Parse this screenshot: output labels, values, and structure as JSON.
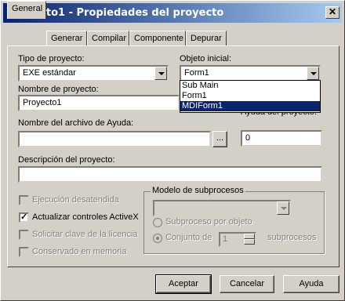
{
  "window": {
    "title": "Proyecto1 - Propiedades del proyecto",
    "close_glyph": "✕"
  },
  "tabs": [
    {
      "label": "General",
      "active": true
    },
    {
      "label": "Generar"
    },
    {
      "label": "Compilar"
    },
    {
      "label": "Componente"
    },
    {
      "label": "Depurar"
    }
  ],
  "general": {
    "project_type_label": "Tipo de proyecto:",
    "project_type_value": "EXE estándar",
    "startup_object_label": "Objeto inicial:",
    "startup_object_value": "Form1",
    "startup_options": [
      "Sub Main",
      "Form1",
      "MDIForm1"
    ],
    "startup_selected_index": 2,
    "project_name_label": "Nombre de proyecto:",
    "project_name_value": "Proyecto1",
    "help_file_label": "Nombre del archivo de Ayuda:",
    "help_file_value": "",
    "browse_label": "...",
    "help_context_label": "Ayuda del proyecto:",
    "help_context_value": "0",
    "description_label": "Descripción del proyecto:",
    "description_value": "",
    "unattended_label": "Ejecución desatendida",
    "upgrade_activex_label": "Actualizar controles ActiveX",
    "license_key_label": "Solicitar clave de la licencia",
    "retained_label": "Conservado en memoria",
    "threading_group_label": "Modelo de subprocesos",
    "thread_per_object_label": "Subproceso por objeto",
    "thread_pool_label": "Conjunto de",
    "thread_pool_value": "1",
    "threads_suffix": "subprocesos"
  },
  "buttons": {
    "ok": "Aceptar",
    "cancel": "Cancelar",
    "help": "Ayuda"
  }
}
